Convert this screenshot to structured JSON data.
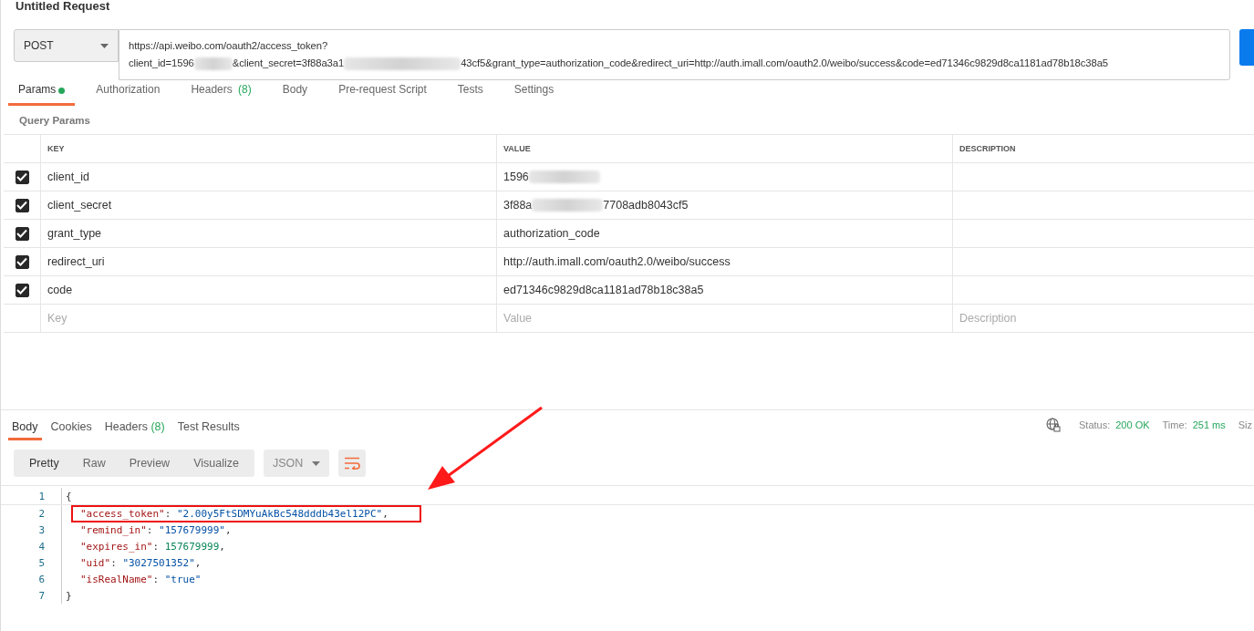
{
  "title": "Untitled Request",
  "request": {
    "method": "POST",
    "url_lines": [
      [
        {
          "text": "https://api.weibo.com/oauth2/access_token?",
          "redacted": false
        }
      ],
      [
        {
          "text": "client_id=1596",
          "redacted": false
        },
        {
          "redacted": true
        },
        {
          "text": "&client_secret=3f88a3a1",
          "redacted": false
        },
        {
          "redacted": true
        },
        {
          "text": "43cf5&grant_type=authorization_code&redirect_uri=http://auth.imall.com/oauth2.0/weibo/success&code=ed71346c9829d8ca1181ad78b18c38a5",
          "redacted": false
        }
      ]
    ]
  },
  "request_tabs": [
    {
      "label": "Params",
      "selected": true,
      "dot": true
    },
    {
      "label": "Authorization",
      "selected": false,
      "dot": false
    },
    {
      "label": "Headers",
      "count": "(8)",
      "selected": false,
      "dot": false
    },
    {
      "label": "Body",
      "selected": false,
      "dot": false
    },
    {
      "label": "Pre-request Script",
      "selected": false,
      "dot": false
    },
    {
      "label": "Tests",
      "selected": false,
      "dot": false
    },
    {
      "label": "Settings",
      "selected": false,
      "dot": false
    }
  ],
  "query_params": {
    "title": "Query Params",
    "columns": [
      "KEY",
      "VALUE",
      "DESCRIPTION"
    ],
    "rows": [
      {
        "checked": true,
        "key": "client_id",
        "value": "1596",
        "value_redacted": true
      },
      {
        "checked": true,
        "key": "client_secret",
        "value": "3f88a",
        "value_redacted": true,
        "value_after": "7708adb8043cf5"
      },
      {
        "checked": true,
        "key": "grant_type",
        "value": "authorization_code",
        "value_redacted": false
      },
      {
        "checked": true,
        "key": "redirect_uri",
        "value": "http://auth.imall.com/oauth2.0/weibo/success",
        "value_redacted": false
      },
      {
        "checked": true,
        "key": "code",
        "value": "ed71346c9829d8ca1181ad78b18c38a5",
        "value_redacted": false
      }
    ],
    "placeholders": [
      "Key",
      "Value",
      "Description"
    ]
  },
  "response_tabs": [
    {
      "label": "Body",
      "selected": true
    },
    {
      "label": "Cookies",
      "selected": false
    },
    {
      "label": "Headers",
      "count": "(8)",
      "selected": false
    },
    {
      "label": "Test Results",
      "selected": false
    }
  ],
  "status": [
    {
      "label": "Status:",
      "value": "200 OK"
    },
    {
      "label": "Time:",
      "value": "251 ms"
    },
    {
      "label": "Siz"
    }
  ],
  "view_modes": [
    {
      "label": "Pretty",
      "selected": true
    },
    {
      "label": "Raw",
      "selected": false
    },
    {
      "label": "Preview",
      "selected": false
    },
    {
      "label": "Visualize",
      "selected": false
    }
  ],
  "format": "JSON",
  "code": [
    {
      "number": "1",
      "kind": "brace",
      "highlighted": false,
      "tokens": [
        {
          "kind": "punct",
          "text": "{"
        }
      ]
    },
    {
      "number": "2",
      "kind": "pair",
      "highlighted": true,
      "tokens": [
        {
          "kind": "key",
          "text": "\"access_token\""
        },
        {
          "kind": "punct",
          "text": ": "
        },
        {
          "kind": "string",
          "text": "\"2.00y5FtSDMYuAkBc548dddb43el12PC\""
        },
        {
          "kind": "punct",
          "text": ","
        }
      ]
    },
    {
      "number": "3",
      "kind": "pair",
      "highlighted": false,
      "tokens": [
        {
          "kind": "key",
          "text": "\"remind_in\""
        },
        {
          "kind": "punct",
          "text": ": "
        },
        {
          "kind": "string",
          "text": "\"157679999\""
        },
        {
          "kind": "punct",
          "text": ","
        }
      ]
    },
    {
      "number": "4",
      "kind": "pair",
      "highlighted": false,
      "tokens": [
        {
          "kind": "key",
          "text": "\"expires_in\""
        },
        {
          "kind": "punct",
          "text": ": "
        },
        {
          "kind": "number",
          "text": "157679999"
        },
        {
          "kind": "punct",
          "text": ","
        }
      ]
    },
    {
      "number": "5",
      "kind": "pair",
      "highlighted": false,
      "tokens": [
        {
          "kind": "key",
          "text": "\"uid\""
        },
        {
          "kind": "punct",
          "text": ": "
        },
        {
          "kind": "string",
          "text": "\"3027501352\""
        },
        {
          "kind": "punct",
          "text": ","
        }
      ]
    },
    {
      "number": "6",
      "kind": "pair",
      "highlighted": false,
      "tokens": [
        {
          "kind": "key",
          "text": "\"isRealName\""
        },
        {
          "kind": "punct",
          "text": ": "
        },
        {
          "kind": "string",
          "text": "\"true\""
        }
      ]
    },
    {
      "number": "7",
      "kind": "brace",
      "highlighted": false,
      "tokens": [
        {
          "kind": "punct",
          "text": "}"
        }
      ]
    }
  ]
}
